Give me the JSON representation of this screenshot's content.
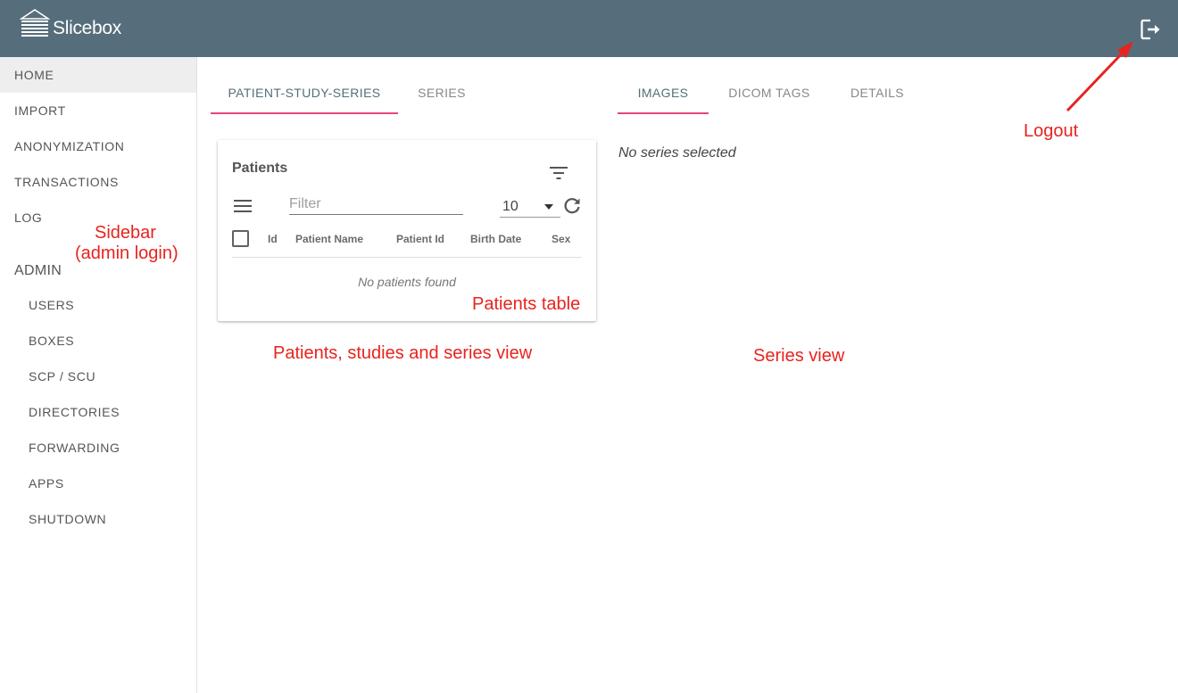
{
  "header": {
    "app_title": "Slicebox",
    "logo_icon": "slicebox-logo-icon",
    "logout_icon": "logout-icon",
    "background_color": "#566e7b"
  },
  "sidebar": {
    "items": [
      {
        "label": "HOME",
        "active": true
      },
      {
        "label": "IMPORT"
      },
      {
        "label": "ANONYMIZATION"
      },
      {
        "label": "TRANSACTIONS"
      },
      {
        "label": "LOG"
      }
    ],
    "admin_header": "ADMIN",
    "admin_items": [
      {
        "label": "USERS"
      },
      {
        "label": "BOXES"
      },
      {
        "label": "SCP / SCU"
      },
      {
        "label": "DIRECTORIES"
      },
      {
        "label": "FORWARDING"
      },
      {
        "label": "APPS"
      },
      {
        "label": "SHUTDOWN"
      }
    ]
  },
  "left_tabs": [
    {
      "label": "PATIENT-STUDY-SERIES",
      "active": true
    },
    {
      "label": "SERIES"
    }
  ],
  "right_tabs": [
    {
      "label": "IMAGES",
      "active": true
    },
    {
      "label": "DICOM TAGS"
    },
    {
      "label": "DETAILS"
    }
  ],
  "patients_card": {
    "title": "Patients",
    "filter_placeholder": "Filter",
    "page_size": "10",
    "columns": [
      "Id",
      "Patient Name",
      "Patient Id",
      "Birth Date",
      "Sex"
    ],
    "empty_message": "No patients found"
  },
  "series_view": {
    "message": "No series selected"
  },
  "annotations": {
    "logout": "Logout",
    "sidebar_line1": "Sidebar",
    "sidebar_line2": "(admin login)",
    "patients_table": "Patients table",
    "pss_view": "Patients, studies and series view",
    "series_view": "Series view"
  },
  "colors": {
    "accent": "#e8467c",
    "annotation": "#e8231e",
    "active_tab_text": "#546e7a"
  }
}
